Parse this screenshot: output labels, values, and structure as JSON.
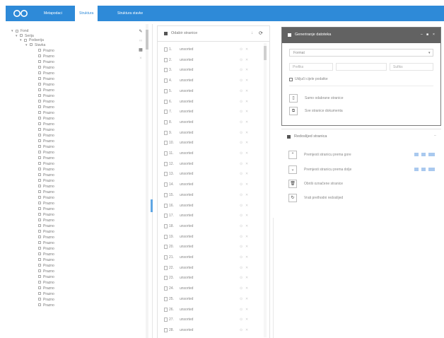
{
  "colors": {
    "accent": "#2e8ad8",
    "panel_header_dark": "#626262"
  },
  "topbar": {
    "logo_icon": "infinity-logo-icon",
    "tabs": [
      "Metapodaci",
      "Struktura",
      "Struktura stavke"
    ],
    "active_tab_index": 1
  },
  "tree": {
    "nodes": [
      {
        "label": "Fond",
        "depth": 0,
        "expanded": true
      },
      {
        "label": "Serija",
        "depth": 1,
        "expanded": true
      },
      {
        "label": "Podserija",
        "depth": 2,
        "expanded": true
      },
      {
        "label": "Stavka",
        "depth": 3,
        "expanded": true
      },
      {
        "label": "Prazno",
        "depth": 4,
        "count": 46
      }
    ],
    "tool_icons": [
      "edit-icon",
      "link-icon",
      "grid-icon",
      "delete-icon"
    ]
  },
  "pages": {
    "title": "Odabir stranice",
    "sort_icon": "sort-icon",
    "refresh_icon": "refresh-icon",
    "row_label": "unsorted",
    "row_count": 28
  },
  "export_panel": {
    "title": "Generiranje datoteka",
    "select_value": "Format",
    "prefix_placeholder": "Prefiks",
    "middle_placeholder": "",
    "suffix_placeholder": "Sufiks",
    "checkbox_label": "Uključi cijele podatke",
    "actions": [
      {
        "icon": "file-icon",
        "label": "Samo odabrane stranice"
      },
      {
        "icon": "files-icon",
        "label": "Sve stranice dokumenta"
      }
    ]
  },
  "layout_panel": {
    "title": "Redoslijed stranica",
    "rows": [
      {
        "icon": "chevron-up-icon",
        "label": "Premjesti stranicu prema gore",
        "has_badges": true
      },
      {
        "icon": "chevron-down-icon",
        "label": "Premjesti stranicu prema dolje",
        "has_badges": true
      },
      {
        "icon": "trash-icon",
        "label": "Obriši označene stranice",
        "has_badges": false
      },
      {
        "icon": "redo-icon",
        "label": "Vrati prethodni redoslijed",
        "has_badges": false
      }
    ]
  }
}
